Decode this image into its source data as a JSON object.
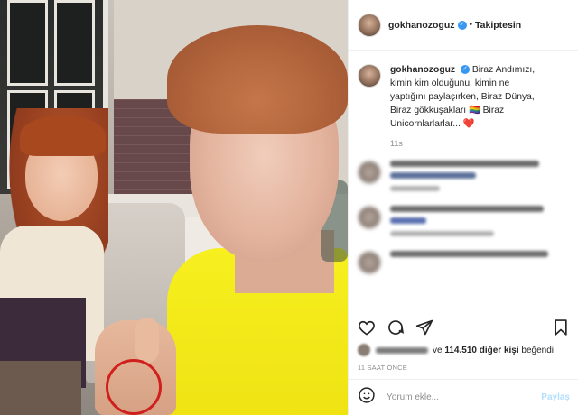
{
  "post": {
    "username": "gokhanozoguz",
    "follow_status": "Takiptesin",
    "separator": "•",
    "caption_lines": [
      "Biraz Andımızı,",
      "kimin kim olduğunu, kimin ne",
      "yaptığını paylaşırken, Biraz Dünya,",
      "Biraz gökkuşakları 🏳️‍🌈 Biraz",
      "Unicornlarlarlar... ❤️"
    ],
    "caption_time": "11s"
  },
  "likes": {
    "text_ve": "ve",
    "count": "114.510",
    "text_rest": "diğer kişi",
    "text_end": "beğendi"
  },
  "time_ago": "11 SAAT ÖNCE",
  "comment_box": {
    "placeholder": "Yorum ekle...",
    "post_label": "Paylaş"
  },
  "icons": {
    "like": "heart-icon",
    "comment": "comment-icon",
    "share": "paper-plane-icon",
    "save": "bookmark-icon",
    "emoji": "emoji-icon",
    "verified": "verified-badge-icon"
  },
  "colors": {
    "verified_blue": "#3897f0",
    "post_button_disabled": "#b2dffc",
    "circle_annotation": "#d0201d"
  }
}
